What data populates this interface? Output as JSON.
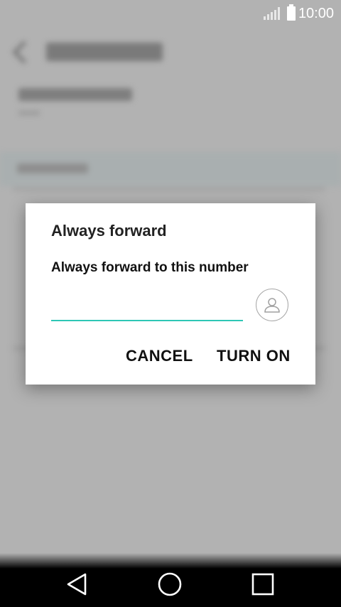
{
  "status_bar": {
    "time": "10:00"
  },
  "dialog": {
    "title": "Always forward",
    "label": "Always forward to this number",
    "input_value": "",
    "cancel_label": "CANCEL",
    "confirm_label": "TURN ON"
  },
  "icons": {
    "contact": "contact-person-icon",
    "back": "back-triangle-icon",
    "home": "home-circle-icon",
    "recent": "recent-apps-square-icon"
  },
  "colors": {
    "input_underline": "#2ec7b5",
    "dialog_bg": "#ffffff",
    "scrim": "#b2b2b2"
  }
}
